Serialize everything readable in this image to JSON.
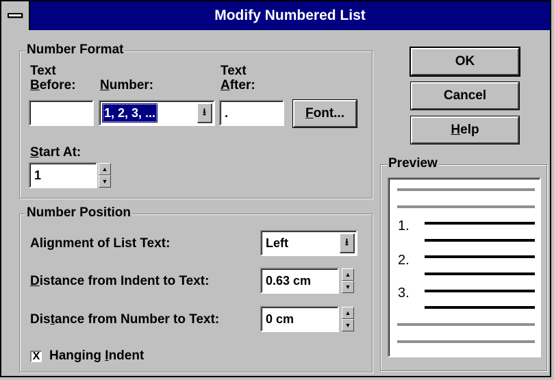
{
  "window": {
    "title": "Modify Numbered List"
  },
  "number_format": {
    "legend": "Number Format",
    "text_before_label_1": "Text",
    "text_before_label_2_u": "B",
    "text_before_label_2_rest": "efore:",
    "text_before_value": "",
    "number_label_u": "N",
    "number_label_rest": "umber:",
    "number_value": "1, 2, 3, ...",
    "text_after_label_1": "Text",
    "text_after_label_2_u": "A",
    "text_after_label_2_rest": "fter:",
    "text_after_value": ".",
    "font_button_u": "F",
    "font_button_rest": "ont...",
    "start_at_label_u": "S",
    "start_at_label_rest": "tart At:",
    "start_at_value": "1"
  },
  "number_position": {
    "legend": "Number Position",
    "alignment_label": "Alignment of List Text:",
    "alignment_value": "Left",
    "indent_label_u": "D",
    "indent_label_rest": "istance from Indent to Text:",
    "indent_value": "0.63 cm",
    "number_text_label_pre": "Dis",
    "number_text_label_u": "t",
    "number_text_label_rest": "ance from Number to Text:",
    "number_text_value": "0 cm",
    "hanging_indent_label_pre": "Hanging ",
    "hanging_indent_label_u": "I",
    "hanging_indent_label_rest": "ndent",
    "hanging_indent_checked": true,
    "hanging_indent_mark": "X"
  },
  "buttons": {
    "ok": "OK",
    "cancel": "Cancel",
    "help_u": "H",
    "help_rest": "elp"
  },
  "preview": {
    "legend": "Preview",
    "numbers": [
      "1.",
      "2.",
      "3."
    ]
  },
  "icons": {
    "dropdown": "⭳",
    "spin_up": "▲",
    "spin_down": "▼"
  },
  "colors": {
    "titlebar": "#000080",
    "face": "#c0c0c0",
    "preview_gray_line": "#909090",
    "preview_black_line": "#000000"
  }
}
